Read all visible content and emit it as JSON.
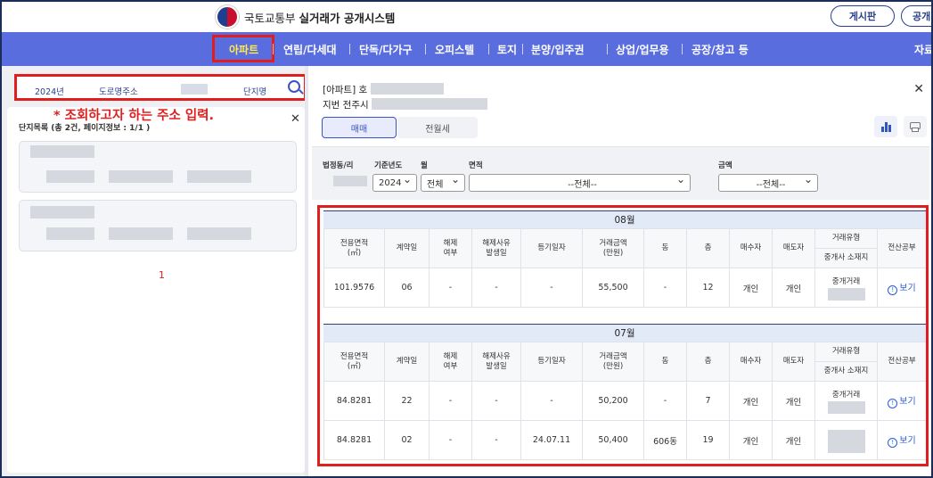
{
  "header": {
    "ministry": "국토교통부",
    "system_name": "실거래가 공개시스템",
    "board_button": "게시판",
    "cut_button": "공개"
  },
  "nav": {
    "items": [
      "아파트",
      "연립/다세대",
      "단독/다가구",
      "오피스텔",
      "토지",
      "분양/입주권",
      "상업/업무용",
      "공장/창고 등",
      "자료"
    ],
    "active": "아파트"
  },
  "search": {
    "year": "2024년",
    "address_type": "도로명주소",
    "complex_name": "단지명"
  },
  "hint": "* 조회하고자 하는 주소 입력.",
  "list": {
    "title": "단지목록 (총 2건, 페이지정보 : 1/1 )",
    "page": "1"
  },
  "detail": {
    "title": "[아파트] 호",
    "subtitle": "지번 전주시",
    "tabs": [
      "매매",
      "전월세"
    ]
  },
  "filters": {
    "dong_label": "법정동/리",
    "year_label": "기준년도",
    "month_label": "월",
    "area_label": "면적",
    "price_label": "금액",
    "year_value": "2024",
    "month_value": "전체",
    "area_value": "--전체--",
    "price_value": "--전체--"
  },
  "table_headers": {
    "area": "전용면적\n(㎡)",
    "contract_day": "계약일",
    "cancel": "해제\n여부",
    "cancel_reason": "해제사유\n발생일",
    "reg_date": "등기일자",
    "price": "거래금액\n(만원)",
    "dong": "동",
    "floor": "층",
    "buyer": "매수자",
    "seller": "매도자",
    "deal_type": "거래유형",
    "agent_loc": "중개사 소재지",
    "registry": "전산공부"
  },
  "months": [
    {
      "label": "08월",
      "rows": [
        {
          "area": "101.9576",
          "day": "06",
          "cancel": "-",
          "reason": "-",
          "reg": "-",
          "price": "55,500",
          "dong": "-",
          "floor": "12",
          "buyer": "개인",
          "seller": "개인",
          "deal": "중개거래",
          "view": "보기"
        }
      ]
    },
    {
      "label": "07월",
      "rows": [
        {
          "area": "84.8281",
          "day": "22",
          "cancel": "-",
          "reason": "-",
          "reg": "-",
          "price": "50,200",
          "dong": "-",
          "floor": "7",
          "buyer": "개인",
          "seller": "개인",
          "deal": "중개거래",
          "view": "보기"
        },
        {
          "area": "84.8281",
          "day": "02",
          "cancel": "-",
          "reason": "-",
          "reg": "24.07.11",
          "price": "50,400",
          "dong": "606동",
          "floor": "19",
          "buyer": "개인",
          "seller": "개인",
          "deal": "",
          "view": "보기"
        }
      ]
    }
  ],
  "colors": {
    "nav_bg": "#5a6ddf",
    "accent": "#2a3f8c",
    "highlight_red": "#e01e1e",
    "link_blue": "#2a5bd7"
  }
}
